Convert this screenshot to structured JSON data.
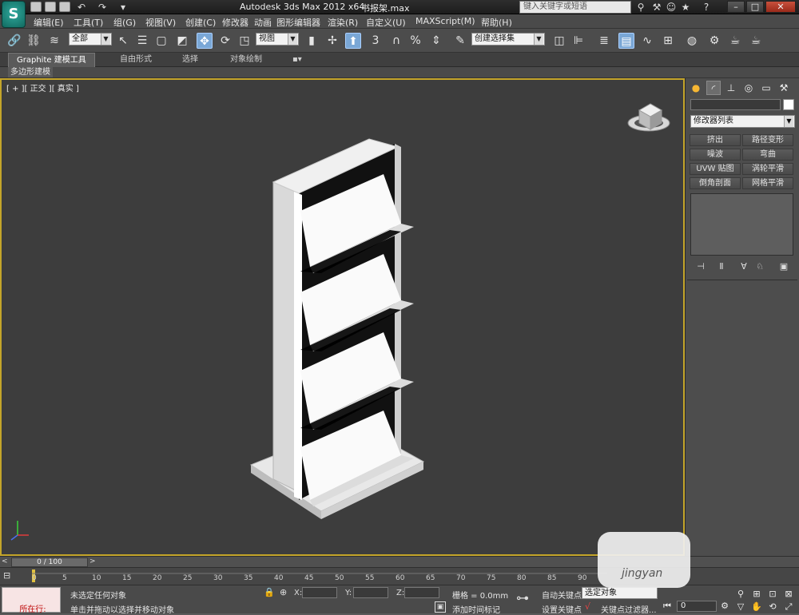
{
  "titlebar": {
    "app_title": "Autodesk 3ds Max  2012 x64",
    "file_name": "书报架.max",
    "search_placeholder": "键入关键字或短语",
    "app_logo": "S"
  },
  "menu": {
    "items": [
      "编辑(E)",
      "工具(T)",
      "组(G)",
      "视图(V)",
      "创建(C)",
      "修改器",
      "动画",
      "图形编辑器",
      "渲染(R)",
      "自定义(U)",
      "MAXScript(M)",
      "帮助(H)"
    ]
  },
  "toolbar": {
    "selection_filter": "全部",
    "reference_coord": "视图",
    "named_selection": "创建选择集",
    "snap_labels": [
      "3",
      "%"
    ]
  },
  "ribbon": {
    "tabs": [
      "Graphite 建模工具",
      "自由形式",
      "选择",
      "对象绘制"
    ],
    "sub_label": "多边形建模"
  },
  "viewport": {
    "label": "[ + ][ 正交 ][ 真实 ]"
  },
  "command_panel": {
    "modifier_list": "修改器列表",
    "buttons": [
      "挤出",
      "路径变形",
      "噪波",
      "弯曲",
      "UVW 贴图",
      "涡轮平滑",
      "倒角剖面",
      "网格平滑"
    ]
  },
  "timeline": {
    "slider_label": "0 / 100",
    "ticks": [
      "0",
      "5",
      "10",
      "15",
      "20",
      "25",
      "30",
      "35",
      "40",
      "45",
      "50",
      "55",
      "60",
      "65",
      "70",
      "75",
      "80",
      "85",
      "90"
    ]
  },
  "status": {
    "maxscript_label": "所在行:",
    "selection_status": "未选定任何对象",
    "prompt": "单击并拖动以选择并移动对象",
    "x_label": "X:",
    "y_label": "Y:",
    "z_label": "Z:",
    "grid": "栅格 = 0.0mm",
    "add_time_tag": "添加时间标记",
    "auto_key": "自动关键点",
    "set_key": "设置关键点",
    "key_mode": "选定对象",
    "key_filters": "关键点过滤器...",
    "frame": "0"
  },
  "watermark": {
    "text": "jingyan"
  },
  "colors": {
    "viewport_border": "#c4a52a",
    "viewport_bg": "#3d3d3d",
    "active_tool": "#7aa7d6"
  }
}
